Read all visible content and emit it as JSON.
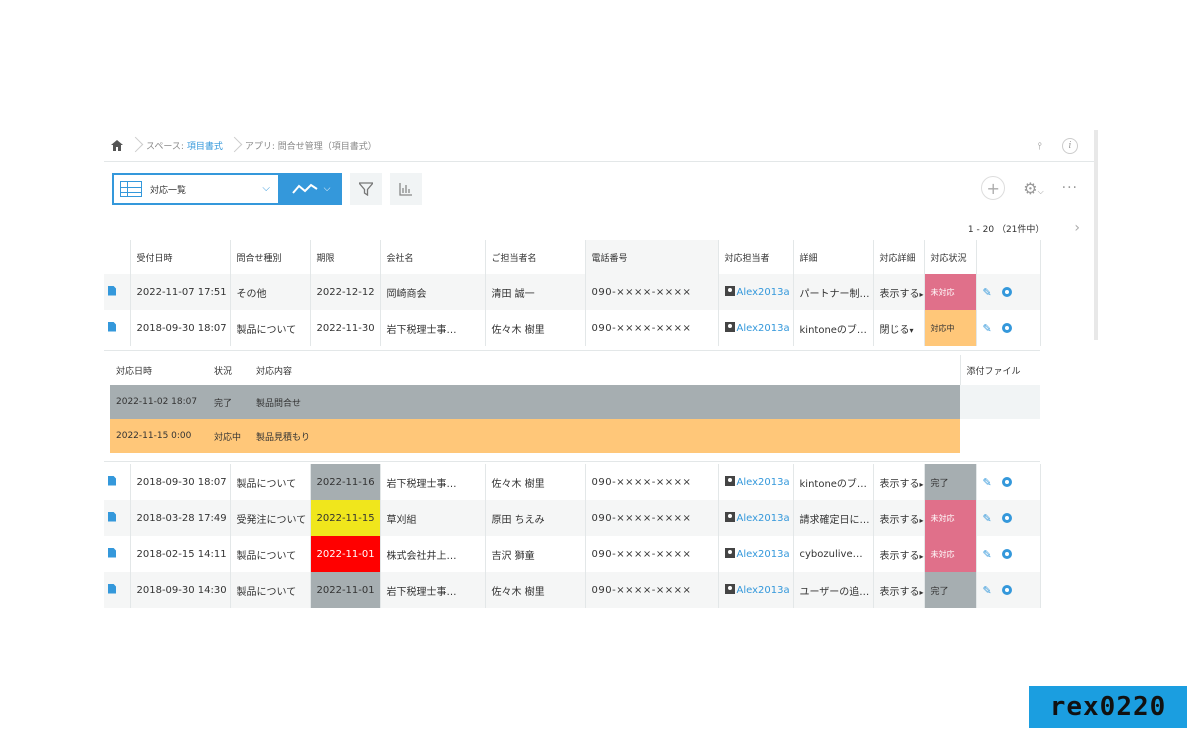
{
  "breadcrumb": {
    "space_prefix": "スペース: ",
    "space_name": "項目書式",
    "app_prefix": "アプリ: ",
    "app_name": "問合せ管理（項目書式）"
  },
  "toolbar": {
    "view_name": "対応一覧"
  },
  "pager": {
    "range": "1 - 20",
    "total": "（21件中）"
  },
  "columns": [
    "受付日時",
    "問合せ種別",
    "期限",
    "会社名",
    "ご担当者名",
    "電話番号",
    "対応担当者",
    "詳細",
    "対応詳細",
    "対応状況"
  ],
  "rows_top": [
    {
      "received": "2022-11-07 17:51",
      "type": "その他",
      "deadline": "2022-12-12",
      "company": "岡崎商会",
      "contact": "清田 誠一",
      "phone": "090-××××-××××",
      "assignee": "Alex2013a",
      "detail": "パートナー制…",
      "toggle": "表示する",
      "status": "未対応"
    },
    {
      "received": "2018-09-30 18:07",
      "type": "製品について",
      "deadline": "2022-11-30",
      "company": "岩下税理士事…",
      "contact": "佐々木 樹里",
      "phone": "090-××××-××××",
      "assignee": "Alex2013a",
      "detail": "kintoneのブ…",
      "toggle": "閉じる",
      "status": "対応中"
    }
  ],
  "subtable": {
    "headers": [
      "対応日時",
      "状況",
      "対応内容",
      "添付ファイル"
    ],
    "rows": [
      {
        "date": "2022-11-02 18:07",
        "state": "完了",
        "content": "製品問合せ"
      },
      {
        "date": "2022-11-15 0:00",
        "state": "対応中",
        "content": "製品見積もり"
      }
    ]
  },
  "rows_bottom": [
    {
      "received": "2018-09-30 18:07",
      "type": "製品について",
      "deadline": "2022-11-16",
      "company": "岩下税理士事…",
      "contact": "佐々木 樹里",
      "phone": "090-××××-××××",
      "assignee": "Alex2013a",
      "detail": "kintoneのブ…",
      "toggle": "表示する",
      "status": "完了"
    },
    {
      "received": "2018-03-28 17:49",
      "type": "受発注について",
      "deadline": "2022-11-15",
      "company": "草刈組",
      "contact": "原田 ちえみ",
      "phone": "090-××××-××××",
      "assignee": "Alex2013a",
      "detail": "請求確定日に…",
      "toggle": "表示する",
      "status": "未対応"
    },
    {
      "received": "2018-02-15 14:11",
      "type": "製品について",
      "deadline": "2022-11-01",
      "company": "株式会社井上…",
      "contact": "吉沢 獅童",
      "phone": "090-××××-××××",
      "assignee": "Alex2013a",
      "detail": "cybozulive…",
      "toggle": "表示する",
      "status": "未対応"
    },
    {
      "received": "2018-09-30 14:30",
      "type": "製品について",
      "deadline": "2022-11-01",
      "company": "岩下税理士事…",
      "contact": "佐々木 樹里",
      "phone": "090-××××-××××",
      "assignee": "Alex2013a",
      "detail": "ユーザーの追…",
      "toggle": "表示する",
      "status": "完了"
    }
  ],
  "colors": {
    "accent": "#3498db",
    "status_unhandled": "#e0708a",
    "status_in_progress": "#ffc779",
    "status_done": "#a6aeb1",
    "deadline_soon": "#f0e61c",
    "deadline_overdue": "#ff0000"
  },
  "icons": [
    "home-icon",
    "pin-icon",
    "info-icon",
    "table-view-icon",
    "graph-icon",
    "filter-icon",
    "chart-icon",
    "plus-icon",
    "gear-icon",
    "more-icon",
    "document-icon",
    "user-icon",
    "pencil-icon",
    "settings-icon"
  ],
  "watermark": "rex0220"
}
